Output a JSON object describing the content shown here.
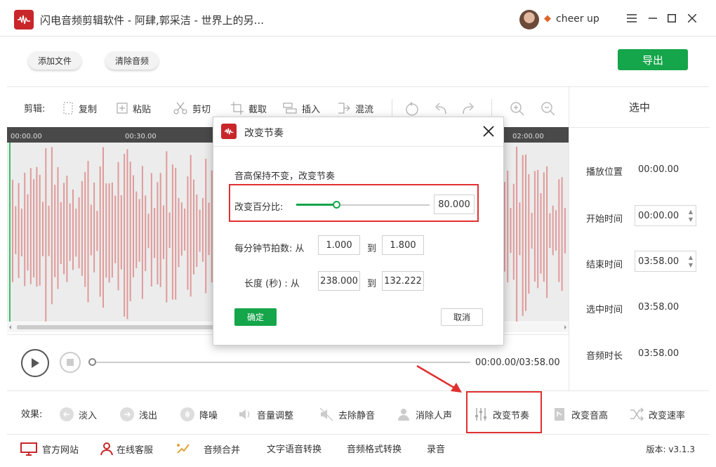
{
  "app": {
    "title": "闪电音频剪辑软件 - 阿肆,郭采洁 - 世界上的另...",
    "user_name": "cheer up",
    "window_controls": [
      "minimize-icon",
      "restore-icon",
      "maximize-icon",
      "close-icon"
    ]
  },
  "top_buttons": {
    "add_file": "添加文件",
    "clear_audio": "清除音频",
    "export": "导出"
  },
  "toolbar": {
    "label": "剪辑:",
    "items": [
      {
        "label": "复制",
        "icon": "copy-icon"
      },
      {
        "label": "粘贴",
        "icon": "paste-icon"
      },
      {
        "label": "剪切",
        "icon": "scissors-icon"
      },
      {
        "label": "截取",
        "icon": "crop-icon"
      },
      {
        "label": "插入",
        "icon": "insert-icon"
      },
      {
        "label": "混流",
        "icon": "mix-icon"
      }
    ],
    "icon_buttons": [
      "loop-icon",
      "undo-icon",
      "redo-icon",
      "zoom-in-icon",
      "zoom-out-icon"
    ]
  },
  "timeline": {
    "ticks": [
      "00:00.00",
      "00:30.00",
      "02:00.00"
    ]
  },
  "player": {
    "time": "00:00.00/03:58.00",
    "progress": 0
  },
  "side_panel": {
    "title": "选中",
    "play_position_label": "播放位置",
    "play_position": "00:00.00",
    "start_time_label": "开始时间",
    "start_time": "00:00.00",
    "end_time_label": "结束时间",
    "end_time": "03:58.00",
    "selected_time_label": "选中时间",
    "selected_time": "03:58.00",
    "duration_label": "音频时长",
    "duration": "03:58.00"
  },
  "effects": {
    "label": "效果:",
    "items": [
      {
        "label": "淡入",
        "icon": "fade-in-icon"
      },
      {
        "label": "浅出",
        "icon": "fade-out-icon"
      },
      {
        "label": "降噪",
        "icon": "denoise-icon"
      },
      {
        "label": "音量调整",
        "icon": "volume-icon"
      },
      {
        "label": "去除静音",
        "icon": "mute-remove-icon"
      },
      {
        "label": "消除人声",
        "icon": "vocal-remove-icon"
      },
      {
        "label": "改变节奏",
        "icon": "tempo-icon"
      },
      {
        "label": "改变音高",
        "icon": "pitch-icon"
      },
      {
        "label": "改变速率",
        "icon": "speed-icon"
      }
    ]
  },
  "footer": {
    "items": [
      {
        "label": "官方网站",
        "icon": "monitor-icon"
      },
      {
        "label": "在线客服",
        "icon": "user-icon"
      },
      {
        "label": "音频合并",
        "icon": "merge-icon"
      },
      {
        "label": "文字语音转换",
        "icon": ""
      },
      {
        "label": "音频格式转换",
        "icon": ""
      },
      {
        "label": "录音",
        "icon": ""
      }
    ],
    "version": "版本: v3.1.3"
  },
  "dialog": {
    "title": "改变节奏",
    "description": "音高保持不变，改变节奏",
    "percent_label": "改变百分比:",
    "percent_value": "80.000",
    "slider_fraction": 0.3,
    "bpm_label": "每分钟节拍数: 从",
    "bpm_from": "1.000",
    "to_label_1": "到",
    "bpm_to": "1.800",
    "length_label": "长度 (秒) : 从",
    "length_from": "238.000",
    "to_label_2": "到",
    "length_to": "132.222",
    "ok": "确定",
    "cancel": "取消"
  },
  "colors": {
    "accent_green": "#15a54a",
    "brand_red": "#c8262b",
    "highlight_red": "#e03030",
    "waveform": "#e09a9a"
  }
}
